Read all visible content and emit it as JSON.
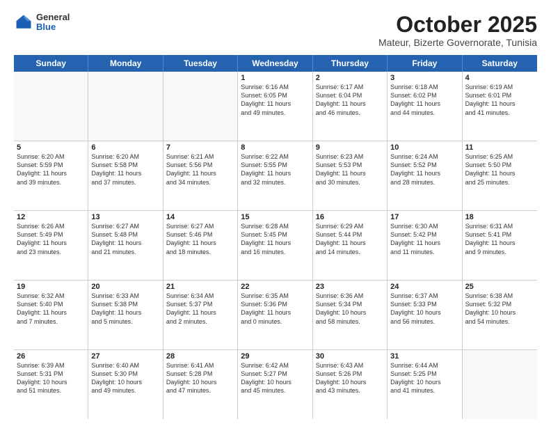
{
  "header": {
    "logo": {
      "general": "General",
      "blue": "Blue"
    },
    "title": "October 2025",
    "subtitle": "Mateur, Bizerte Governorate, Tunisia"
  },
  "calendar": {
    "days": [
      "Sunday",
      "Monday",
      "Tuesday",
      "Wednesday",
      "Thursday",
      "Friday",
      "Saturday"
    ],
    "rows": [
      [
        {
          "day": "",
          "info": ""
        },
        {
          "day": "",
          "info": ""
        },
        {
          "day": "",
          "info": ""
        },
        {
          "day": "1",
          "info": "Sunrise: 6:16 AM\nSunset: 6:05 PM\nDaylight: 11 hours\nand 49 minutes."
        },
        {
          "day": "2",
          "info": "Sunrise: 6:17 AM\nSunset: 6:04 PM\nDaylight: 11 hours\nand 46 minutes."
        },
        {
          "day": "3",
          "info": "Sunrise: 6:18 AM\nSunset: 6:02 PM\nDaylight: 11 hours\nand 44 minutes."
        },
        {
          "day": "4",
          "info": "Sunrise: 6:19 AM\nSunset: 6:01 PM\nDaylight: 11 hours\nand 41 minutes."
        }
      ],
      [
        {
          "day": "5",
          "info": "Sunrise: 6:20 AM\nSunset: 5:59 PM\nDaylight: 11 hours\nand 39 minutes."
        },
        {
          "day": "6",
          "info": "Sunrise: 6:20 AM\nSunset: 5:58 PM\nDaylight: 11 hours\nand 37 minutes."
        },
        {
          "day": "7",
          "info": "Sunrise: 6:21 AM\nSunset: 5:56 PM\nDaylight: 11 hours\nand 34 minutes."
        },
        {
          "day": "8",
          "info": "Sunrise: 6:22 AM\nSunset: 5:55 PM\nDaylight: 11 hours\nand 32 minutes."
        },
        {
          "day": "9",
          "info": "Sunrise: 6:23 AM\nSunset: 5:53 PM\nDaylight: 11 hours\nand 30 minutes."
        },
        {
          "day": "10",
          "info": "Sunrise: 6:24 AM\nSunset: 5:52 PM\nDaylight: 11 hours\nand 28 minutes."
        },
        {
          "day": "11",
          "info": "Sunrise: 6:25 AM\nSunset: 5:50 PM\nDaylight: 11 hours\nand 25 minutes."
        }
      ],
      [
        {
          "day": "12",
          "info": "Sunrise: 6:26 AM\nSunset: 5:49 PM\nDaylight: 11 hours\nand 23 minutes."
        },
        {
          "day": "13",
          "info": "Sunrise: 6:27 AM\nSunset: 5:48 PM\nDaylight: 11 hours\nand 21 minutes."
        },
        {
          "day": "14",
          "info": "Sunrise: 6:27 AM\nSunset: 5:46 PM\nDaylight: 11 hours\nand 18 minutes."
        },
        {
          "day": "15",
          "info": "Sunrise: 6:28 AM\nSunset: 5:45 PM\nDaylight: 11 hours\nand 16 minutes."
        },
        {
          "day": "16",
          "info": "Sunrise: 6:29 AM\nSunset: 5:44 PM\nDaylight: 11 hours\nand 14 minutes."
        },
        {
          "day": "17",
          "info": "Sunrise: 6:30 AM\nSunset: 5:42 PM\nDaylight: 11 hours\nand 11 minutes."
        },
        {
          "day": "18",
          "info": "Sunrise: 6:31 AM\nSunset: 5:41 PM\nDaylight: 11 hours\nand 9 minutes."
        }
      ],
      [
        {
          "day": "19",
          "info": "Sunrise: 6:32 AM\nSunset: 5:40 PM\nDaylight: 11 hours\nand 7 minutes."
        },
        {
          "day": "20",
          "info": "Sunrise: 6:33 AM\nSunset: 5:38 PM\nDaylight: 11 hours\nand 5 minutes."
        },
        {
          "day": "21",
          "info": "Sunrise: 6:34 AM\nSunset: 5:37 PM\nDaylight: 11 hours\nand 2 minutes."
        },
        {
          "day": "22",
          "info": "Sunrise: 6:35 AM\nSunset: 5:36 PM\nDaylight: 11 hours\nand 0 minutes."
        },
        {
          "day": "23",
          "info": "Sunrise: 6:36 AM\nSunset: 5:34 PM\nDaylight: 10 hours\nand 58 minutes."
        },
        {
          "day": "24",
          "info": "Sunrise: 6:37 AM\nSunset: 5:33 PM\nDaylight: 10 hours\nand 56 minutes."
        },
        {
          "day": "25",
          "info": "Sunrise: 6:38 AM\nSunset: 5:32 PM\nDaylight: 10 hours\nand 54 minutes."
        }
      ],
      [
        {
          "day": "26",
          "info": "Sunrise: 6:39 AM\nSunset: 5:31 PM\nDaylight: 10 hours\nand 51 minutes."
        },
        {
          "day": "27",
          "info": "Sunrise: 6:40 AM\nSunset: 5:30 PM\nDaylight: 10 hours\nand 49 minutes."
        },
        {
          "day": "28",
          "info": "Sunrise: 6:41 AM\nSunset: 5:28 PM\nDaylight: 10 hours\nand 47 minutes."
        },
        {
          "day": "29",
          "info": "Sunrise: 6:42 AM\nSunset: 5:27 PM\nDaylight: 10 hours\nand 45 minutes."
        },
        {
          "day": "30",
          "info": "Sunrise: 6:43 AM\nSunset: 5:26 PM\nDaylight: 10 hours\nand 43 minutes."
        },
        {
          "day": "31",
          "info": "Sunrise: 6:44 AM\nSunset: 5:25 PM\nDaylight: 10 hours\nand 41 minutes."
        },
        {
          "day": "",
          "info": ""
        }
      ]
    ]
  }
}
